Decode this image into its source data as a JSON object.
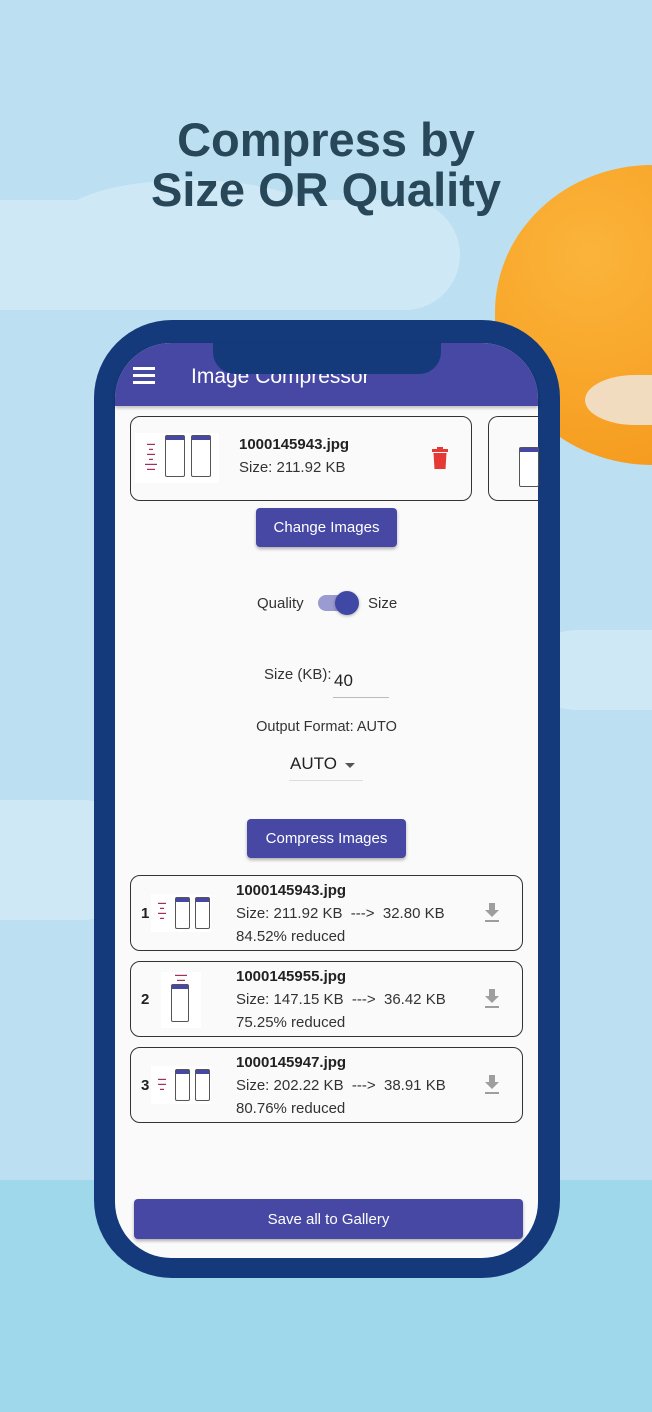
{
  "headline": {
    "line1": "Compress by",
    "line2": "Size OR Quality"
  },
  "colors": {
    "primary": "#4648a4",
    "phone_frame": "#143a7c",
    "delete": "#e53935",
    "sun": "#f7a528"
  },
  "app": {
    "title": "Image Compressor",
    "menu_icon": "hamburger-menu-icon"
  },
  "selected_images": [
    {
      "name": "1000145943.jpg",
      "size": "Size: 211.92 KB"
    }
  ],
  "change_images_label": "Change Images",
  "mode": {
    "left_label": "Quality",
    "right_label": "Size",
    "selected": "Size"
  },
  "size_field": {
    "label": "Size (KB):",
    "value": "40"
  },
  "output_format": {
    "label": "Output Format: AUTO",
    "selected": "AUTO"
  },
  "compress_label": "Compress Images",
  "results": [
    {
      "index": "1",
      "name": "1000145943.jpg",
      "size": "Size: 211.92 KB  --->  32.80 KB",
      "reduced": "84.52% reduced"
    },
    {
      "index": "2",
      "name": "1000145955.jpg",
      "size": "Size: 147.15 KB  --->  36.42 KB",
      "reduced": "75.25% reduced"
    },
    {
      "index": "3",
      "name": "1000145947.jpg",
      "size": "Size: 202.22 KB  --->  38.91 KB",
      "reduced": "80.76% reduced"
    }
  ],
  "save_all_label": "Save all to Gallery"
}
